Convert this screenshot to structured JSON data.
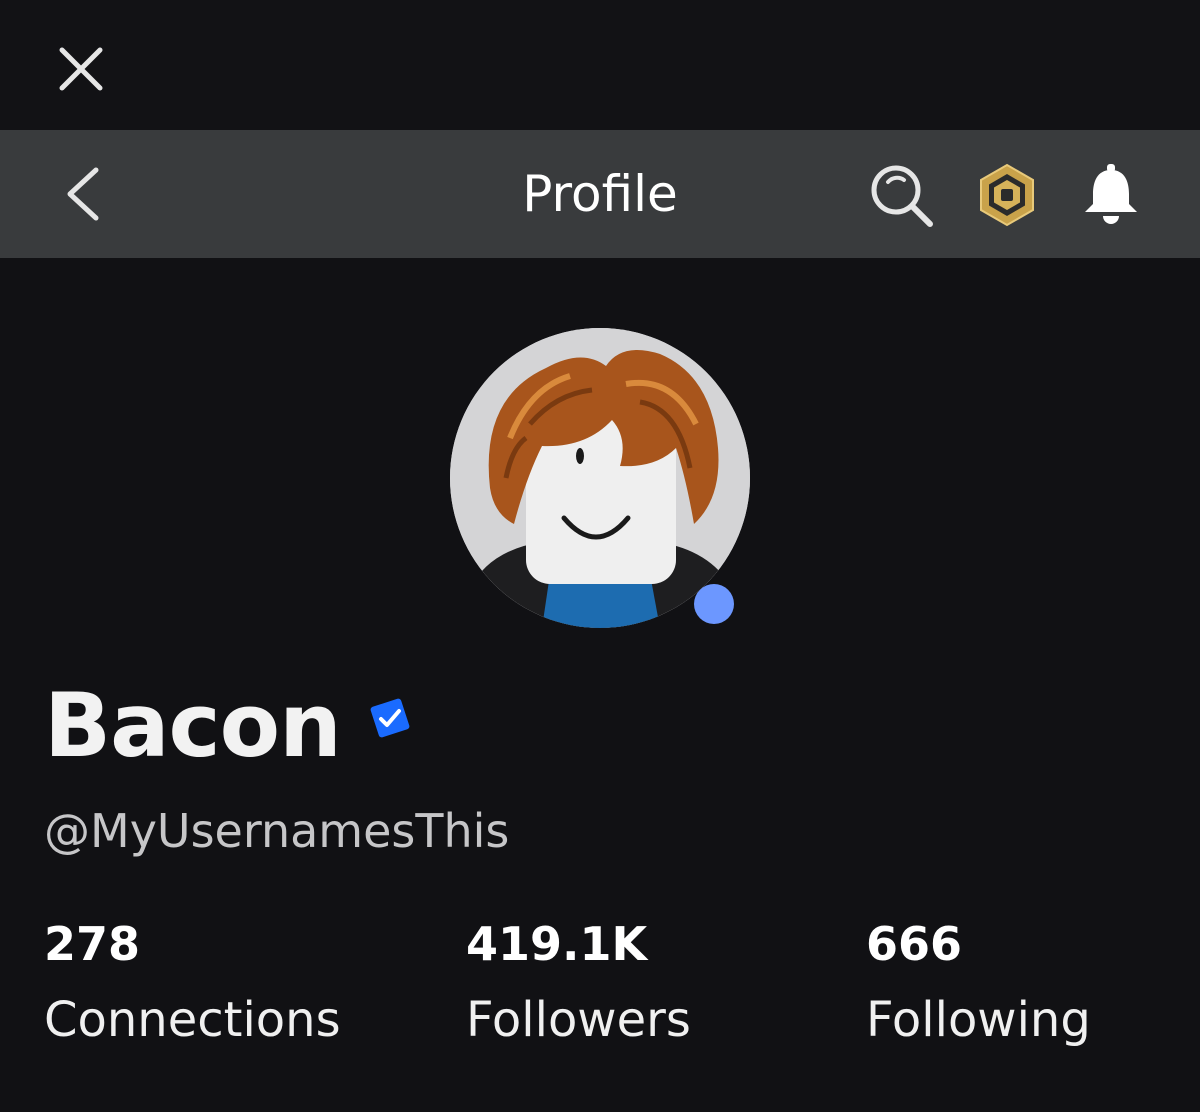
{
  "header": {
    "title": "Profile",
    "icons": {
      "close": "close-icon",
      "back": "chevron-left-icon",
      "search": "search-icon",
      "robux": "robux-icon",
      "notifications": "bell-icon"
    }
  },
  "profile": {
    "display_name": "Bacon",
    "username": "@MyUsernamesThis",
    "verified": true,
    "online_status_color": "#6c97ff"
  },
  "stats": [
    {
      "value": "278",
      "label": "Connections"
    },
    {
      "value": "419.1K",
      "label": "Followers"
    },
    {
      "value": "666",
      "label": "Following"
    }
  ],
  "colors": {
    "background": "#111114",
    "header_bar": "#393b3d",
    "verified_badge": "#1a6bff",
    "robux_gold": "#c9a24a"
  }
}
